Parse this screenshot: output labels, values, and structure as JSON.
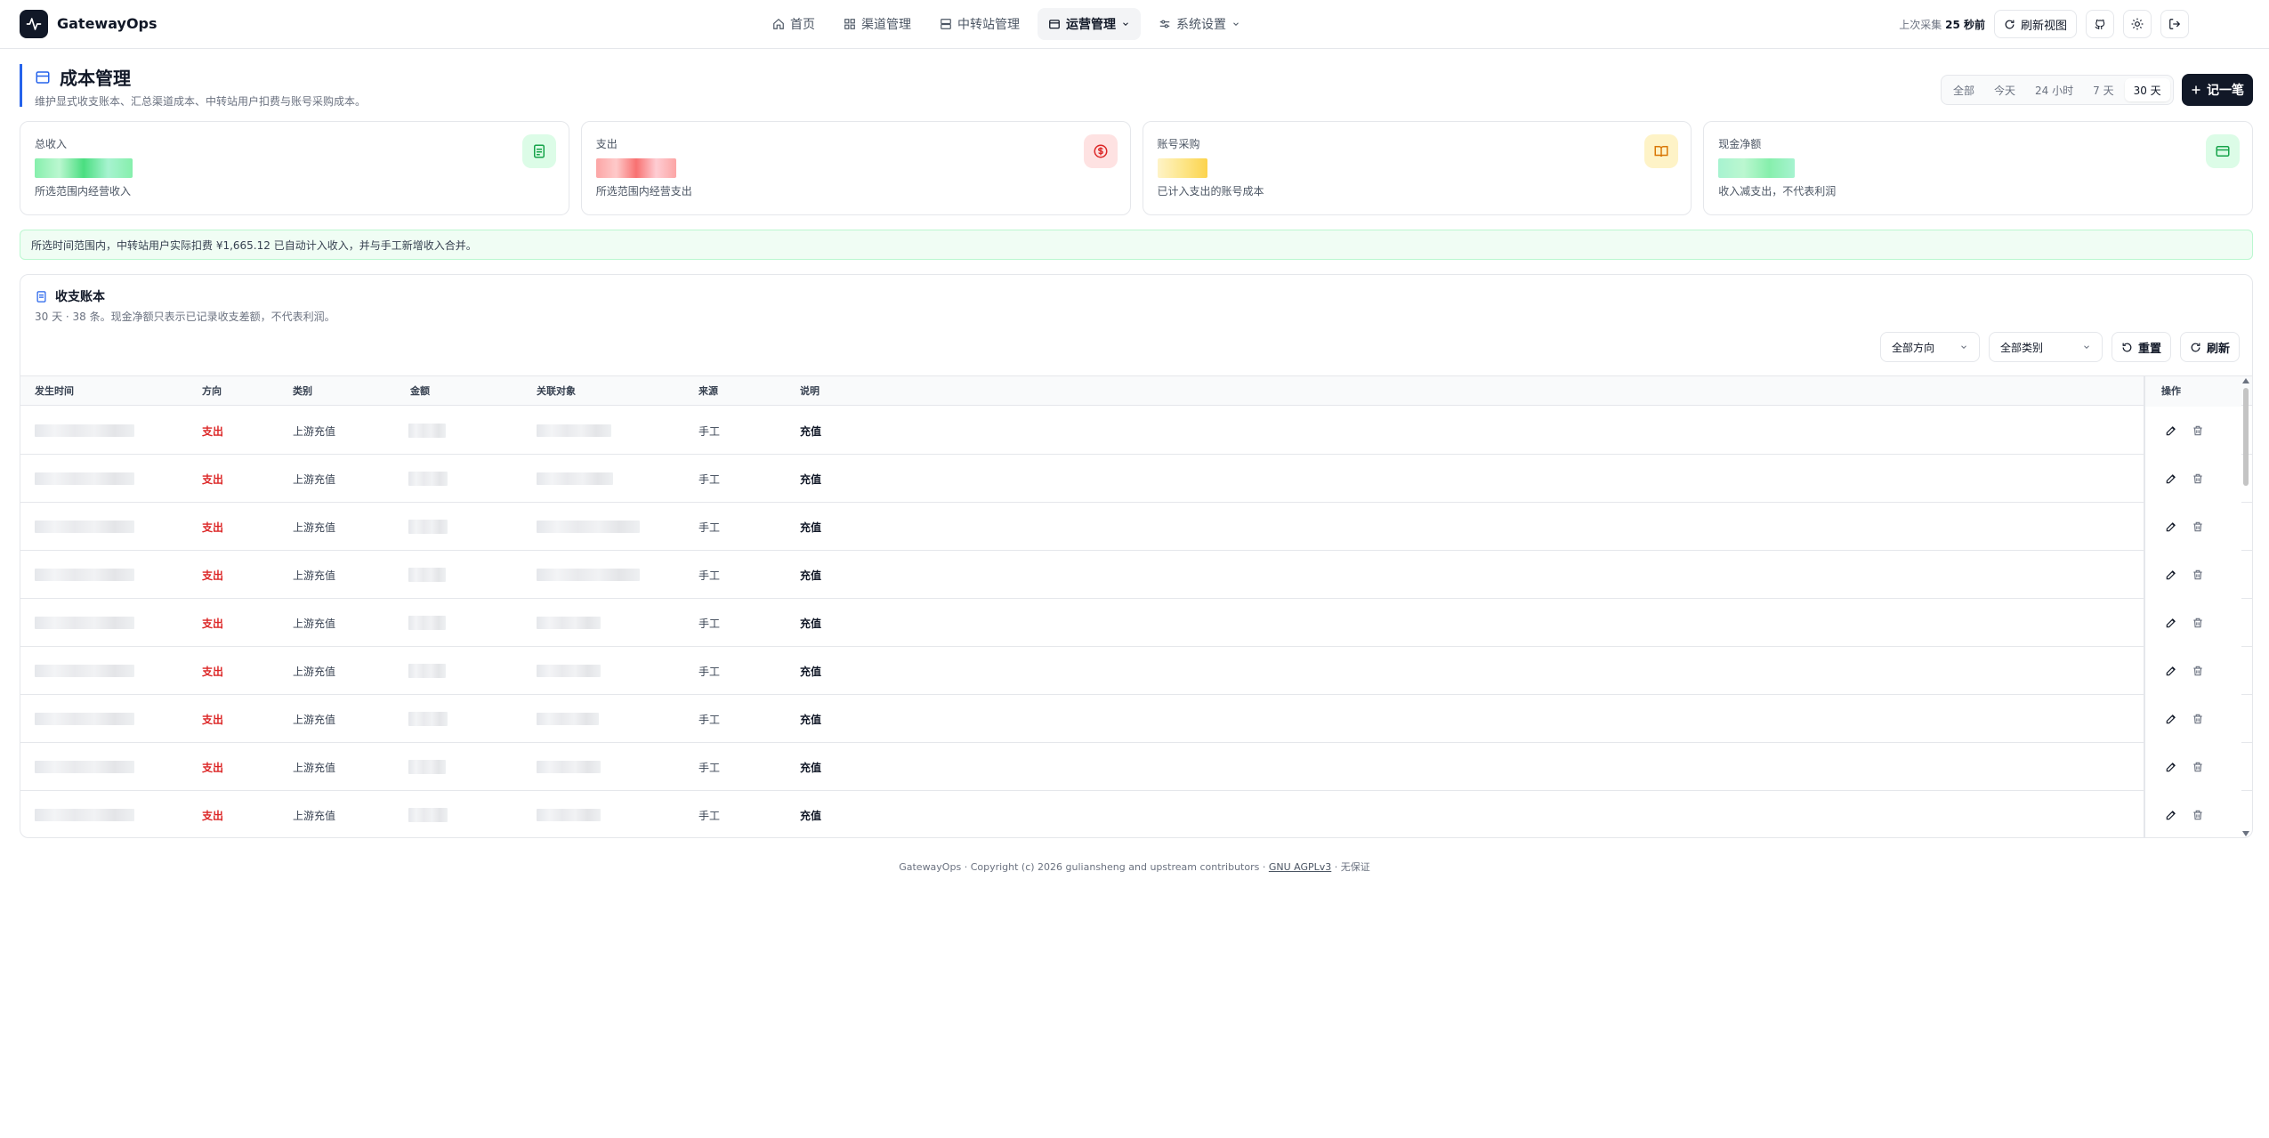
{
  "app": {
    "brand": "GatewayOps"
  },
  "nav": [
    {
      "label": "首页",
      "icon": "home-icon"
    },
    {
      "label": "渠道管理",
      "icon": "grid-icon"
    },
    {
      "label": "中转站管理",
      "icon": "server-icon"
    },
    {
      "label": "运营管理",
      "icon": "wallet-icon",
      "active": true,
      "dropdown": true
    },
    {
      "label": "系统设置",
      "icon": "sliders-icon",
      "dropdown": true
    }
  ],
  "topbar": {
    "collect_prefix": "上次采集",
    "collect_value": "25 秒前",
    "refresh_view": "刷新视图"
  },
  "page": {
    "title": "成本管理",
    "subtitle": "维护显式收支账本、汇总渠道成本、中转站用户扣费与账号采购成本。",
    "add_label": "记一笔"
  },
  "ranges": [
    "全部",
    "今天",
    "24 小时",
    "7 天",
    "30 天"
  ],
  "active_range": "30 天",
  "cards": [
    {
      "label": "总收入",
      "sub": "所选范围内经营收入",
      "icon": "document-icon",
      "tint": "#dcfce7",
      "accent": "#16a34a"
    },
    {
      "label": "支出",
      "sub": "所选范围内经营支出",
      "icon": "dollar-icon",
      "tint": "#fee2e2",
      "accent": "#dc2626"
    },
    {
      "label": "账号采购",
      "sub": "已计入支出的账号成本",
      "icon": "book-icon",
      "tint": "#fef3c7",
      "accent": "#d97706"
    },
    {
      "label": "现金净额",
      "sub": "收入减支出，不代表利润",
      "icon": "wallet-icon",
      "tint": "#dcfce7",
      "accent": "#16a34a"
    }
  ],
  "notice": "所选时间范围内，中转站用户实际扣费 ¥1,665.12 已自动计入收入，并与手工新增收入合并。",
  "ledger": {
    "title": "收支账本",
    "subtitle": "30 天 · 38 条。现金净额只表示已记录收支差额，不代表利润。",
    "filter_direction": "全部方向",
    "filter_category": "全部类别",
    "reset": "重置",
    "refresh": "刷新",
    "columns": [
      "发生时间",
      "方向",
      "类别",
      "金额",
      "关联对象",
      "来源",
      "说明",
      "操作"
    ],
    "rows": [
      {
        "direction": "支出",
        "category": "上游充值",
        "source": "手工",
        "desc": "充值"
      },
      {
        "direction": "支出",
        "category": "上游充值",
        "source": "手工",
        "desc": "充值"
      },
      {
        "direction": "支出",
        "category": "上游充值",
        "source": "手工",
        "desc": "充值"
      },
      {
        "direction": "支出",
        "category": "上游充值",
        "source": "手工",
        "desc": "充值"
      },
      {
        "direction": "支出",
        "category": "上游充值",
        "source": "手工",
        "desc": "充值"
      },
      {
        "direction": "支出",
        "category": "上游充值",
        "source": "手工",
        "desc": "充值"
      },
      {
        "direction": "支出",
        "category": "上游充值",
        "source": "手工",
        "desc": "充值"
      },
      {
        "direction": "支出",
        "category": "上游充值",
        "source": "手工",
        "desc": "充值"
      },
      {
        "direction": "支出",
        "category": "上游充值",
        "source": "手工",
        "desc": "充值"
      }
    ]
  },
  "footer": {
    "brand": "GatewayOps",
    "copyright": "Copyright (c) 2026 guliansheng and upstream contributors",
    "license": "GNU AGPLv3",
    "warranty": "无保证"
  }
}
